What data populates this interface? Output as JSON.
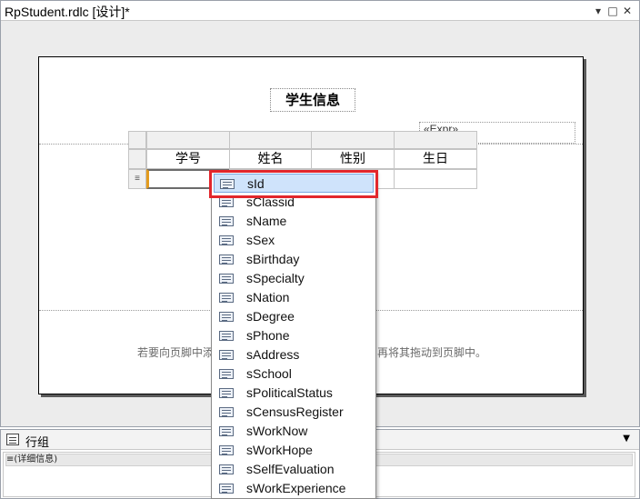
{
  "window": {
    "title": "RpStudent.rdlc [设计]*",
    "controls": {
      "dropdown": "▾",
      "restore": "□",
      "close": "✕"
    }
  },
  "report": {
    "header_title": "学生信息",
    "header_expr": "«Expr»",
    "table": {
      "columns": [
        "学号",
        "姓名",
        "性别",
        "生日"
      ],
      "row_handle_glyph": "≡"
    },
    "footer_hint_left": "若要向页脚中添加",
    "footer_hint_right": "再将其拖动到页脚中。"
  },
  "field_list": {
    "items": [
      "sId",
      "sClassid",
      "sName",
      "sSex",
      "sBirthday",
      "sSpecialty",
      "sNation",
      "sDegree",
      "sPhone",
      "sAddress",
      "sSchool",
      "sPoliticalStatus",
      "sCensusRegister",
      "sWorkNow",
      "sWorkHope",
      "sSelfEvaluation",
      "sWorkExperience"
    ],
    "selected": "sId",
    "icon": "field-icon"
  },
  "grouping": {
    "title": "行组",
    "dropdown": "▼",
    "detail_group": "≡(详细信息)"
  },
  "colors": {
    "highlight": "#e2262c",
    "selection_fill": "#cfe3fb",
    "cell_marker": "#e49c1e"
  }
}
